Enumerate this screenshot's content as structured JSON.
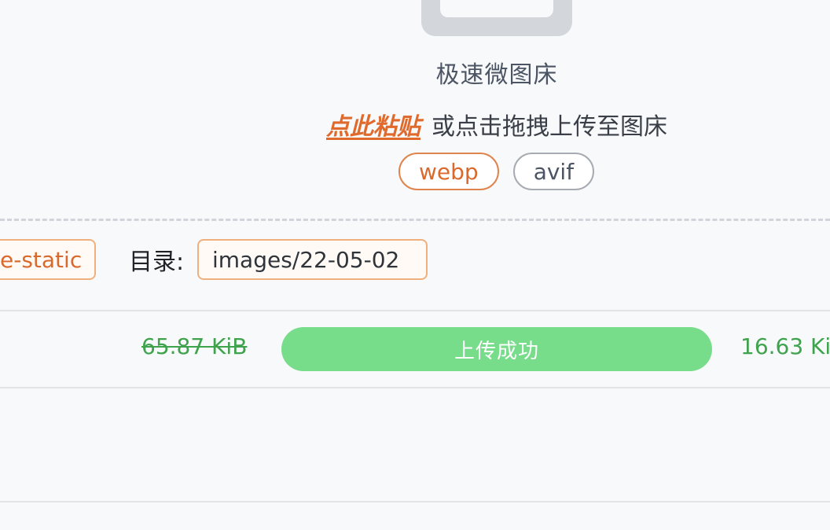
{
  "header": {
    "app_title": "极速微图床",
    "paste_link": "点此粘贴",
    "paste_hint": "或点击拖拽上传至图床",
    "formats": [
      {
        "label": "webp",
        "selected": true
      },
      {
        "label": "avif",
        "selected": false
      }
    ]
  },
  "config": {
    "bucket_value": "e-static",
    "dir_label": "目录:",
    "dir_value": "images/22-05-02"
  },
  "uploads": [
    {
      "original_size": "65.87 KiB",
      "status": "上传成功",
      "compressed_size": "16.63 Ki"
    }
  ],
  "colors": {
    "accent": "#d9692c",
    "success": "#77dd8a",
    "size_text": "#3fa34d"
  },
  "icons": {
    "upload": "upload-image-icon"
  }
}
